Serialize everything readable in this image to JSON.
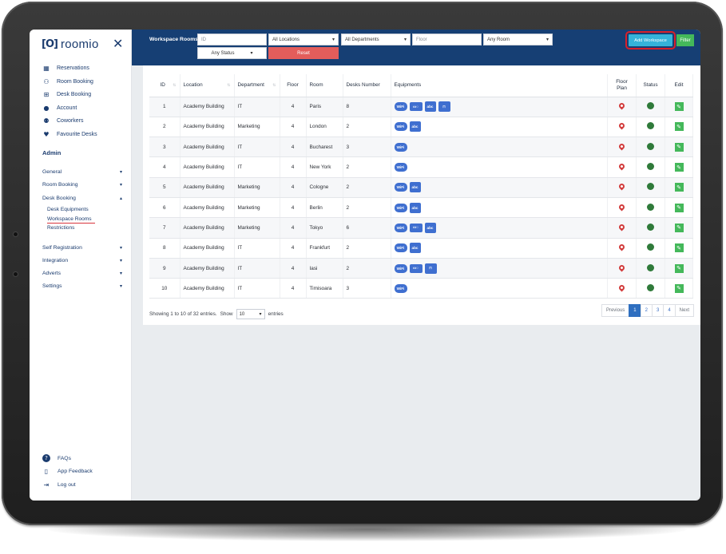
{
  "app": {
    "logo_mark": "[O]",
    "logo_text": "roomio",
    "close": "✕"
  },
  "sidebar": {
    "items": [
      {
        "label": "Reservations",
        "icon": "calendar-icon",
        "glyph": "▦"
      },
      {
        "label": "Room Booking",
        "icon": "meeting-icon",
        "glyph": "⚇"
      },
      {
        "label": "Desk Booking",
        "icon": "desk-icon",
        "glyph": "⊞"
      },
      {
        "label": "Account",
        "icon": "user-icon",
        "glyph": "●"
      },
      {
        "label": "Coworkers",
        "icon": "users-icon",
        "glyph": "⚉"
      },
      {
        "label": "Favourite Desks",
        "icon": "heart-icon",
        "glyph": "♥"
      }
    ],
    "admin_title": "Admin",
    "menu": [
      {
        "label": "General",
        "caret": "▾"
      },
      {
        "label": "Room Booking",
        "caret": "▾"
      },
      {
        "label": "Desk Booking",
        "caret": "▴"
      },
      {
        "label": "Self Registration",
        "caret": "▾"
      },
      {
        "label": "Integration",
        "caret": "▾"
      },
      {
        "label": "Adverts",
        "caret": "▾"
      },
      {
        "label": "Settings",
        "caret": "▾"
      }
    ],
    "sub_items": [
      "Desk Equipments",
      "Workspace Rooms",
      "Restrictions"
    ],
    "bottom": [
      {
        "label": "FAQs",
        "icon": "help-icon",
        "glyph": "?"
      },
      {
        "label": "App Feedback",
        "icon": "phone-icon",
        "glyph": "▯"
      },
      {
        "label": "Log out",
        "icon": "logout-icon",
        "glyph": "⇥"
      }
    ]
  },
  "topbar": {
    "title": "Workspace Rooms",
    "id_placeholder": "ID",
    "location": "All Locations",
    "department": "All Departments",
    "floor_placeholder": "Floor",
    "room": "Any Room",
    "status": "Any Status",
    "reset": "Reset",
    "add": "Add Workspace",
    "filter": "Filter",
    "caret": "▾"
  },
  "table": {
    "headers": {
      "id": "ID",
      "location": "Location",
      "department": "Department",
      "floor": "Floor",
      "room": "Room",
      "desks": "Desks Number",
      "equipments": "Equipments",
      "floor_plan": "Floor Plan",
      "status": "Status",
      "edit": "Edit"
    },
    "sort_glyph": "⇅",
    "equipment_labels": {
      "wifi": "WiFi",
      "proj": "▭○",
      "board": "abc",
      "desk": "⊓"
    },
    "edit_glyph": "✎",
    "rows": [
      {
        "id": "1",
        "location": "Academy Building",
        "department": "IT",
        "floor": "4",
        "room": "Paris",
        "desks": "8",
        "eq": [
          "wifi",
          "proj",
          "board",
          "desk"
        ]
      },
      {
        "id": "2",
        "location": "Academy Building",
        "department": "Marketing",
        "floor": "4",
        "room": "London",
        "desks": "2",
        "eq": [
          "wifi",
          "board"
        ]
      },
      {
        "id": "3",
        "location": "Academy Building",
        "department": "IT",
        "floor": "4",
        "room": "Bucharest",
        "desks": "3",
        "eq": [
          "wifi"
        ]
      },
      {
        "id": "4",
        "location": "Academy Building",
        "department": "IT",
        "floor": "4",
        "room": "New York",
        "desks": "2",
        "eq": [
          "wifi"
        ]
      },
      {
        "id": "5",
        "location": "Academy Building",
        "department": "Marketing",
        "floor": "4",
        "room": "Cologne",
        "desks": "2",
        "eq": [
          "wifi",
          "board"
        ]
      },
      {
        "id": "6",
        "location": "Academy Building",
        "department": "Marketing",
        "floor": "4",
        "room": "Berlin",
        "desks": "2",
        "eq": [
          "wifi",
          "board"
        ]
      },
      {
        "id": "7",
        "location": "Academy Building",
        "department": "Marketing",
        "floor": "4",
        "room": "Tokyo",
        "desks": "6",
        "eq": [
          "wifi",
          "proj",
          "board"
        ]
      },
      {
        "id": "8",
        "location": "Academy Building",
        "department": "IT",
        "floor": "4",
        "room": "Frankfurt",
        "desks": "2",
        "eq": [
          "wifi",
          "board"
        ]
      },
      {
        "id": "9",
        "location": "Academy Building",
        "department": "IT",
        "floor": "4",
        "room": "Iasi",
        "desks": "2",
        "eq": [
          "wifi",
          "proj",
          "desk"
        ]
      },
      {
        "id": "10",
        "location": "Academy Building",
        "department": "IT",
        "floor": "4",
        "room": "Timisoara",
        "desks": "3",
        "eq": [
          "wifi"
        ]
      }
    ]
  },
  "footer": {
    "showing": "Showing 1 to 10 of 32 entries.",
    "show_label": "Show",
    "show_value": "10",
    "entries_label": "entries",
    "pager": [
      "Previous",
      "1",
      "2",
      "3",
      "4",
      "Next"
    ],
    "active_page": "1"
  },
  "colors": {
    "navy": "#163f74",
    "add": "#35b3d9",
    "filter": "#44b85a",
    "reset": "#e35d5b",
    "highlight": "#d8202a",
    "status_ok": "#2f7a3a"
  }
}
